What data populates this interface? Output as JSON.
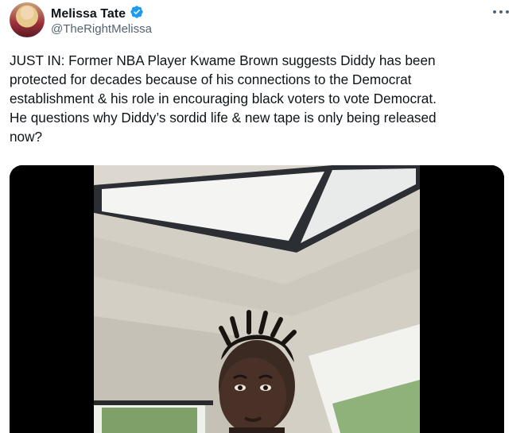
{
  "tweet": {
    "author_name": "Melissa Tate",
    "author_handle": "@TheRightMelissa",
    "text": "JUST IN: Former NBA Player Kwame Brown suggests Diddy has been\nprotected for decades because of his connections to the Democrat\nestablishment & his role in encouraging black voters to vote Democrat.\nHe questions why Diddy’s sordid life & new tape is only being released\nnow?",
    "verified": true
  },
  "icons": {
    "verified": "verified-badge-icon",
    "more": "more-options-icon"
  },
  "colors": {
    "accent": "#1d9bf0",
    "text_primary": "#0f1419",
    "text_secondary": "#536471"
  }
}
